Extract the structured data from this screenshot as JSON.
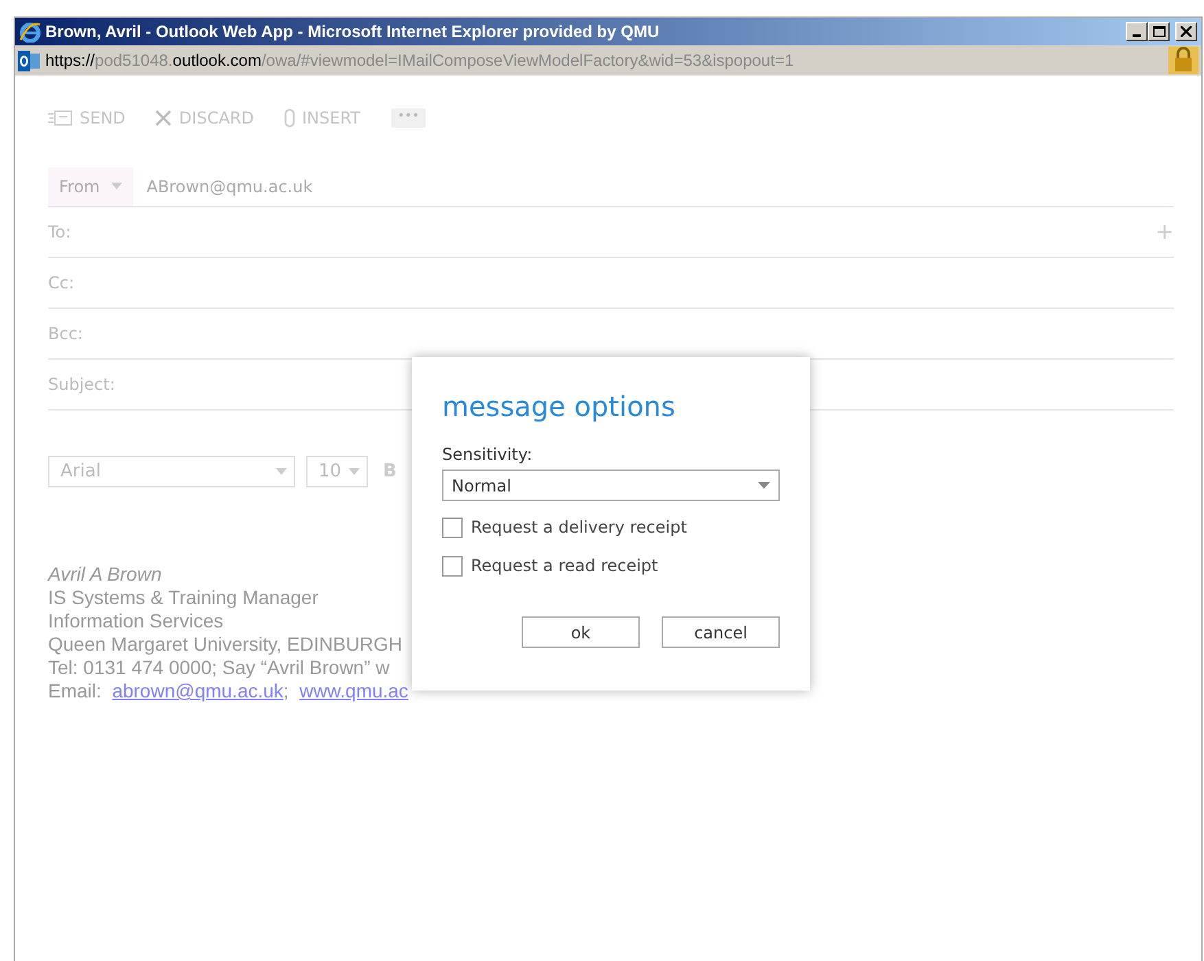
{
  "window": {
    "title": "Brown, Avril - Outlook Web App - Microsoft Internet Explorer provided by QMU"
  },
  "address_bar": {
    "parts": [
      {
        "text": "https://",
        "emphasis": true
      },
      {
        "text": "pod51048.",
        "emphasis": false
      },
      {
        "text": "outlook.com",
        "emphasis": true
      },
      {
        "text": "/owa/#viewmodel=IMailComposeViewModelFactory&wid=53&ispopout=1",
        "emphasis": false
      }
    ]
  },
  "toolbar": [
    {
      "kind": "send",
      "label": "SEND"
    },
    {
      "kind": "discard",
      "label": "DISCARD"
    },
    {
      "kind": "insert",
      "label": "INSERT"
    },
    {
      "kind": "more",
      "label": "•••"
    }
  ],
  "from": {
    "label": "From",
    "value": "ABrown@qmu.ac.uk"
  },
  "fields": [
    {
      "label": "To:",
      "action": "+"
    },
    {
      "label": "Cc:"
    },
    {
      "label": "Bcc:"
    },
    {
      "label": "Subject:"
    }
  ],
  "format_bar": {
    "font": "Arial",
    "size": "10",
    "bold": "B"
  },
  "signature": [
    {
      "kind": "name",
      "text": "Avril A Brown"
    },
    {
      "kind": "plain",
      "text": "IS Systems & Training Manager"
    },
    {
      "kind": "plain",
      "text": "Information Services"
    },
    {
      "kind": "plain",
      "text": "Queen Margaret University, EDINBURGH"
    },
    {
      "kind": "plain",
      "text": "Tel:  0131 474 0000;  Say “Avril Brown” w"
    },
    {
      "kind": "links",
      "parts": [
        {
          "text": "Email:  ",
          "link": false
        },
        {
          "text": "abrown@qmu.ac.uk",
          "link": true
        },
        {
          "text": ";  ",
          "link": false
        },
        {
          "text": "www.qmu.ac",
          "link": true
        }
      ]
    }
  ],
  "dialog": {
    "title": "message options",
    "sensitivity_label": "Sensitivity:",
    "sensitivity_value": "Normal",
    "checkboxes": [
      {
        "label": "Request a delivery receipt",
        "checked": false
      },
      {
        "label": "Request a read receipt",
        "checked": false
      }
    ],
    "buttons": [
      "ok",
      "cancel"
    ]
  }
}
